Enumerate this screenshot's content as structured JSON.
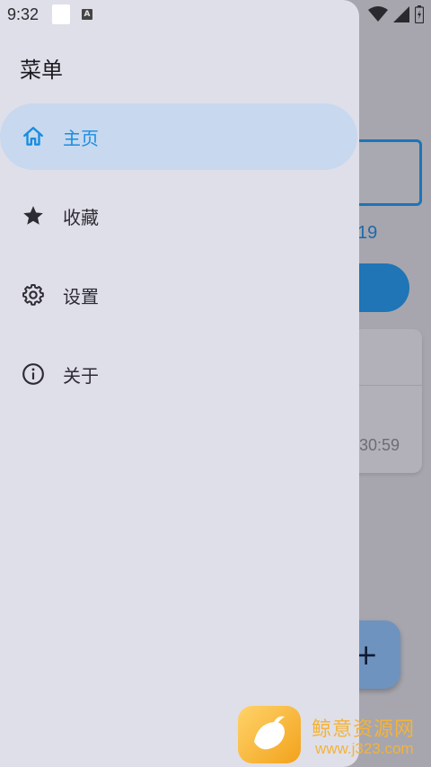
{
  "status_bar": {
    "time": "9:32",
    "icons": [
      "notification-box",
      "a-icon",
      "wifi-icon",
      "signal-icon",
      "battery-icon"
    ]
  },
  "background_app": {
    "number_fragment": "19",
    "time_fragment": ":30:59",
    "fab_symbol": "+"
  },
  "drawer": {
    "title": "菜单",
    "items": [
      {
        "label": "主页",
        "icon": "home-icon",
        "active": true
      },
      {
        "label": "收藏",
        "icon": "star-icon",
        "active": false
      },
      {
        "label": "设置",
        "icon": "gear-icon",
        "active": false
      },
      {
        "label": "关于",
        "icon": "info-icon",
        "active": false
      }
    ]
  },
  "watermark": {
    "name": "鲸意资源网",
    "url": "www.j323.com"
  },
  "colors": {
    "drawer_bg": "#dfdfe9",
    "active_pill": "#c7d8ef",
    "active_accent": "#1a8de0",
    "text": "#2d2c33"
  }
}
